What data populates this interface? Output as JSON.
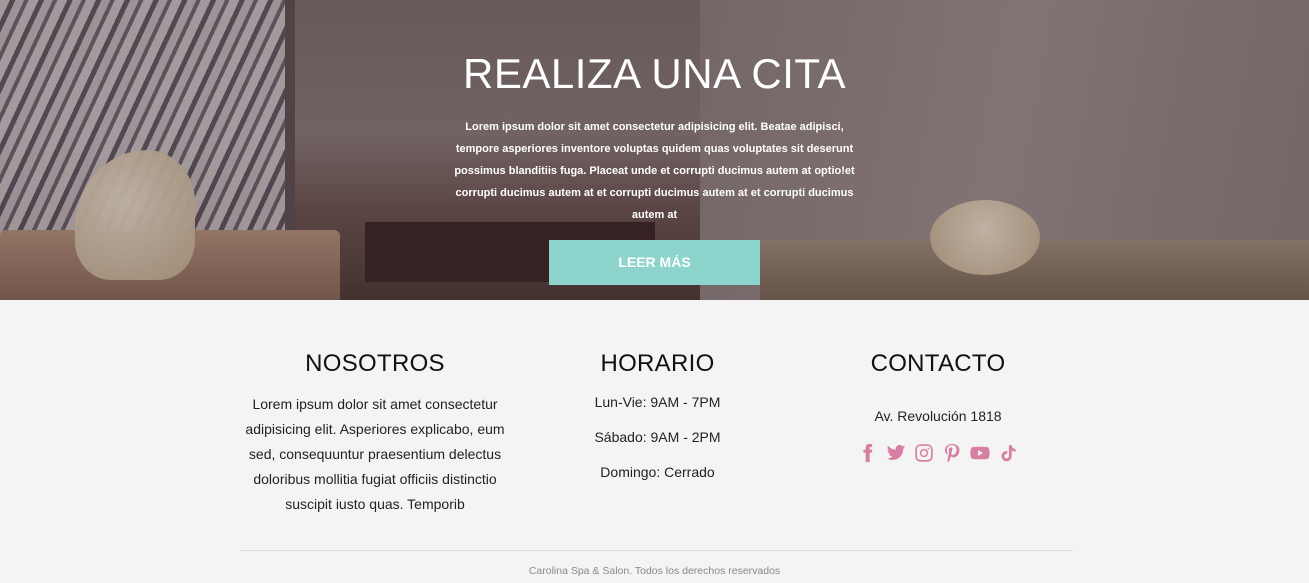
{
  "hero": {
    "title": "REALIZA UNA CITA",
    "text": "Lorem ipsum dolor sit amet consectetur adipisicing elit. Beatae adipisci, tempore asperiores inventore voluptas quidem quas voluptates sit deserunt possimus blanditiis fuga. Placeat unde et corrupti ducimus autem at optio!et corrupti ducimus autem at et corrupti ducimus autem at et corrupti ducimus autem at",
    "button_label": "LEER MÁS",
    "button_color": "#8dd4cc"
  },
  "about": {
    "title": "NOSOTROS",
    "text": "Lorem ipsum dolor sit amet consectetur adipisicing elit. Asperiores explicabo, eum sed, consequuntur praesentium delectus doloribus mollitia fugiat officiis distinctio suscipit iusto quas. Temporib"
  },
  "hours": {
    "title": "HORARIO",
    "items": [
      "Lun-Vie: 9AM - 7PM",
      "Sábado: 9AM - 2PM",
      "Domingo: Cerrado"
    ]
  },
  "contact": {
    "title": "CONTACTO",
    "address": "Av. Revolución 1818",
    "social_icon_color": "#d77fa3",
    "socials": [
      "facebook-icon",
      "twitter-icon",
      "instagram-icon",
      "pinterest-icon",
      "youtube-icon",
      "tiktok-icon"
    ]
  },
  "footer": {
    "copyright": "Carolina Spa & Salon. Todos los derechos reservados"
  }
}
